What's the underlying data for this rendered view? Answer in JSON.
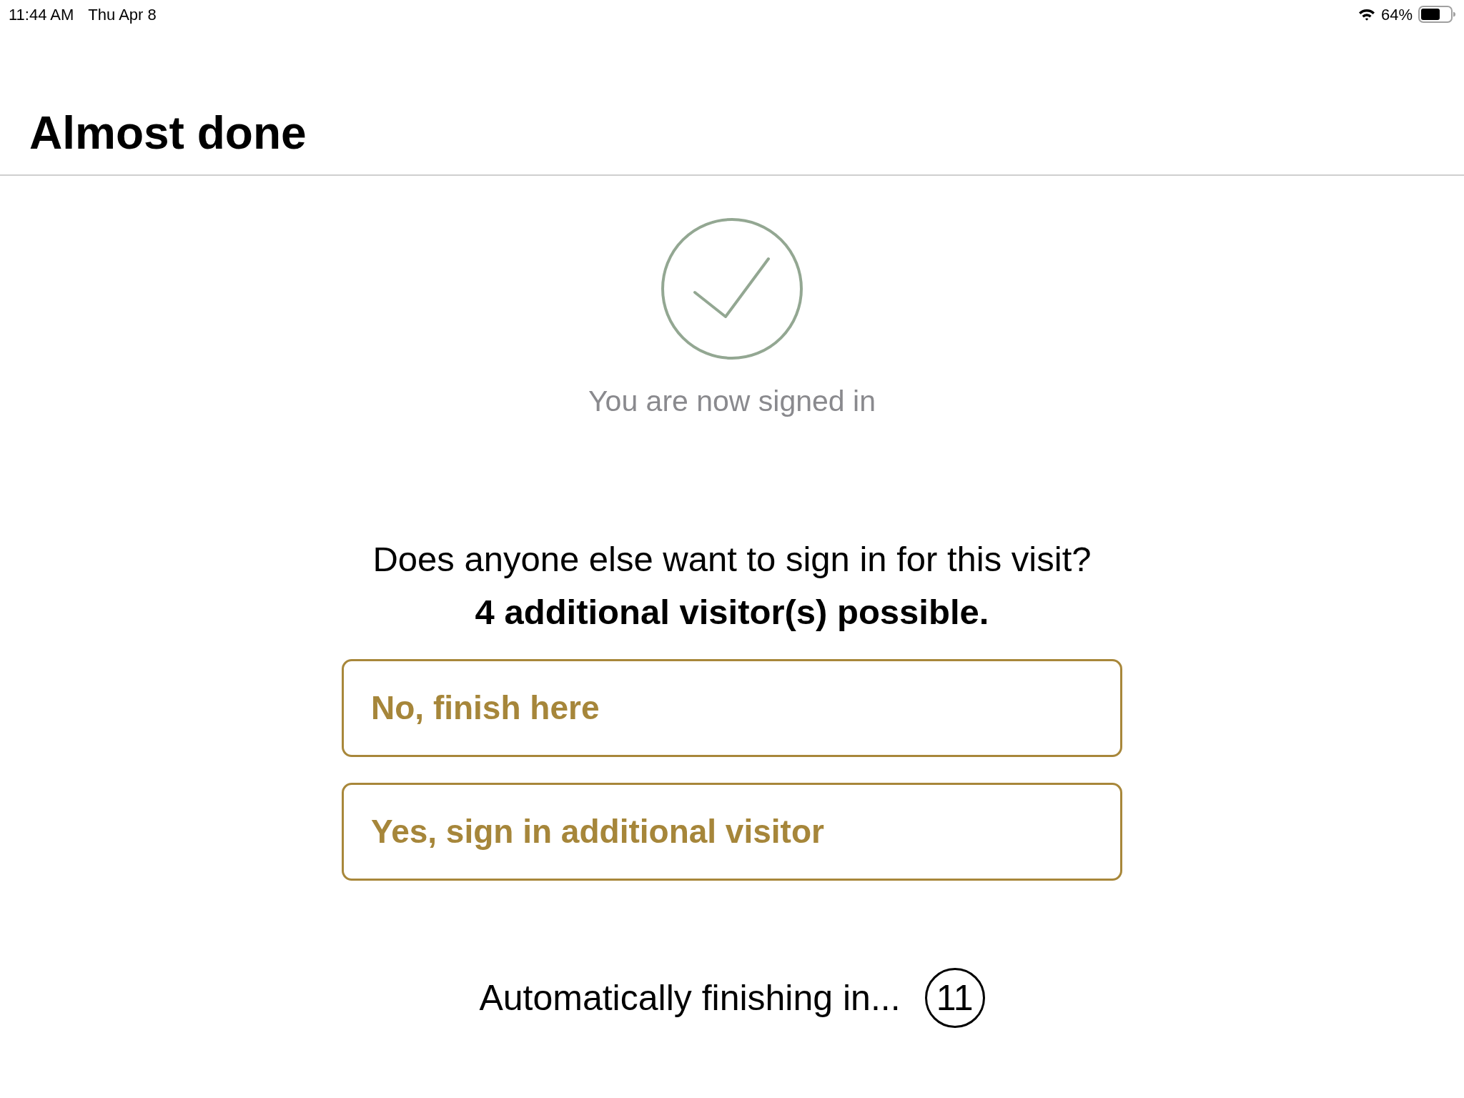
{
  "status_bar": {
    "time": "11:44 AM",
    "date": "Thu Apr 8",
    "battery_percent": "64%"
  },
  "header": {
    "title": "Almost done"
  },
  "confirmation": {
    "message": "You are now signed in"
  },
  "prompt": {
    "question": "Does anyone else want to sign in for this visit?",
    "note": "4 additional visitor(s) possible."
  },
  "options": [
    {
      "label": "No, finish here"
    },
    {
      "label": "Yes, sign in additional visitor"
    }
  ],
  "countdown": {
    "label": "Automatically finishing in...",
    "seconds": "11"
  }
}
